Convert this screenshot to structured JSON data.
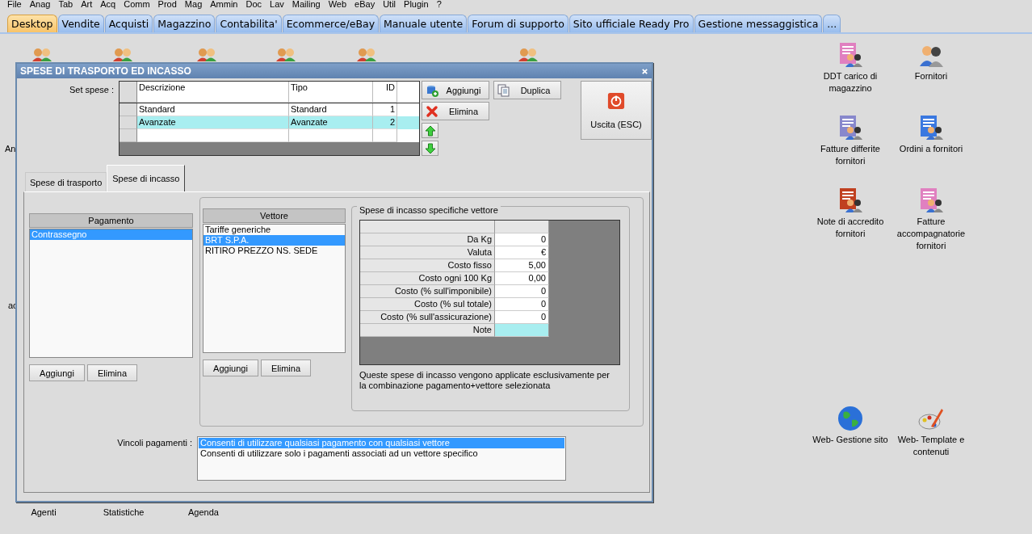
{
  "menu": [
    "File",
    "Anag",
    "Tab",
    "Art",
    "Acq",
    "Comm",
    "Prod",
    "Mag",
    "Ammin",
    "Doc",
    "Lav",
    "Mailing",
    "Web",
    "eBay",
    "Util",
    "Plugin",
    "?"
  ],
  "tabs": [
    {
      "label": "Desktop",
      "selected": true
    },
    {
      "label": "Vendite",
      "selected": false
    },
    {
      "label": "Acquisti",
      "selected": false
    },
    {
      "label": "Magazzino",
      "selected": false
    },
    {
      "label": "Contabilita'",
      "selected": false
    },
    {
      "label": "Ecommerce/eBay",
      "selected": false
    },
    {
      "label": "Manuale utente",
      "selected": false
    },
    {
      "label": "Forum di supporto",
      "selected": false
    },
    {
      "label": "Sito ufficiale Ready Pro",
      "selected": false
    },
    {
      "label": "Gestione messaggistica",
      "selected": false
    },
    {
      "label": "...",
      "selected": false
    }
  ],
  "desktop": {
    "covered_labels": [
      "An",
      "ac"
    ],
    "bottom_labels": [
      "Agenti",
      "Statistiche",
      "Agenda"
    ],
    "icons": [
      {
        "label": "DDT carico di magazzino",
        "kind": "document",
        "color": "#e080c0"
      },
      {
        "label": "Fornitori",
        "kind": "people"
      },
      {
        "label": "Fatture differite fornitori",
        "kind": "document",
        "color": "#8888cc"
      },
      {
        "label": "Ordini a fornitori",
        "kind": "document",
        "color": "#3a78e0"
      },
      {
        "label": "Note di accredito fornitori",
        "kind": "document",
        "color": "#c04020"
      },
      {
        "label": "Fatture accompagnatorie fornitori",
        "kind": "document",
        "color": "#e080c0"
      },
      {
        "label": "Web- Gestione sito",
        "kind": "globe"
      },
      {
        "label": "Web- Template e contenuti",
        "kind": "palette"
      }
    ]
  },
  "dialog": {
    "title": "SPESE DI TRASPORTO ED INCASSO",
    "set_label": "Set spese :",
    "set_table": {
      "columns": [
        "Descrizione",
        "Tipo",
        "ID"
      ],
      "rows": [
        {
          "cells": [
            "Standard",
            "Standard",
            "1"
          ],
          "selected": false
        },
        {
          "cells": [
            "Avanzate",
            "Avanzate",
            "2"
          ],
          "selected": true
        }
      ]
    },
    "add_button": "Aggiungi",
    "duplicate_button": "Duplica",
    "delete_button": "Elimina",
    "exit_button": "Uscita (ESC)",
    "tabs": [
      {
        "label": "Spese di trasporto",
        "selected": false
      },
      {
        "label": "Spese di incasso",
        "selected": true
      }
    ],
    "payments": {
      "header": "Pagamento",
      "items": [
        {
          "label": "Contrassegno",
          "selected": true
        }
      ],
      "add_button": "Aggiungi",
      "delete_button": "Elimina"
    },
    "carriers": {
      "header": "Vettore",
      "items": [
        {
          "label": "Tariffe generiche",
          "selected": false
        },
        {
          "label": "BRT S.P.A.",
          "selected": true
        },
        {
          "label": "RITIRO PREZZO NS. SEDE",
          "selected": false
        }
      ],
      "add_button": "Aggiungi",
      "delete_button": "Elimina"
    },
    "specific": {
      "title": "Spese di incasso specifiche vettore",
      "rows": [
        {
          "label": "Da Kg",
          "value": "0",
          "highlighted": false
        },
        {
          "label": "Valuta",
          "value": "€",
          "highlighted": false
        },
        {
          "label": "Costo fisso",
          "value": "5,00",
          "highlighted": false
        },
        {
          "label": "Costo ogni 100 Kg",
          "value": "0,00",
          "highlighted": false
        },
        {
          "label": "Costo (% sull'imponibile)",
          "value": "0",
          "highlighted": false
        },
        {
          "label": "Costo (% sul totale)",
          "value": "0",
          "highlighted": false
        },
        {
          "label": "Costo (% sull'assicurazione)",
          "value": "0",
          "highlighted": false
        },
        {
          "label": "Note",
          "value": "",
          "highlighted": true
        }
      ],
      "note": "Queste spese di incasso vengono applicate esclusivamente per la combinazione pagamento+vettore selezionata"
    },
    "constraints": {
      "label": "Vincoli pagamenti :",
      "options": [
        {
          "label": "Consenti di utilizzare qualsiasi pagamento con qualsiasi vettore",
          "selected": true
        },
        {
          "label": "Consenti di utilizzare solo i pagamenti associati ad un vettore specifico",
          "selected": false
        }
      ]
    }
  }
}
